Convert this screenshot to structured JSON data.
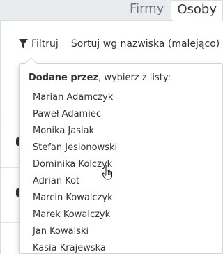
{
  "tabs": [
    {
      "label": "Firmy",
      "active": false
    },
    {
      "label": "Osoby",
      "active": true
    }
  ],
  "toolbar": {
    "filter_label": "Filtruj",
    "sort_label": "Sortuj wg nazwiska (malejąco)"
  },
  "dropdown": {
    "header_bold": "Dodane przez",
    "header_rest": ", wybierz z listy:",
    "items": [
      "Marian Adamczyk",
      "Paweł Adamiec",
      "Monika Jasiak",
      "Stefan Jesionowski",
      "Dominika Kolczyk",
      "Adrian Kot",
      "Marcin Kowalczyk",
      "Marek Kowalczyk",
      "Jan Kowalski",
      "Kasia Krajewska"
    ]
  },
  "icons": {
    "filter": "filter-funnel-icon",
    "sort_caret": "chevron-down-icon",
    "cursor": "hand-pointer-icon"
  }
}
